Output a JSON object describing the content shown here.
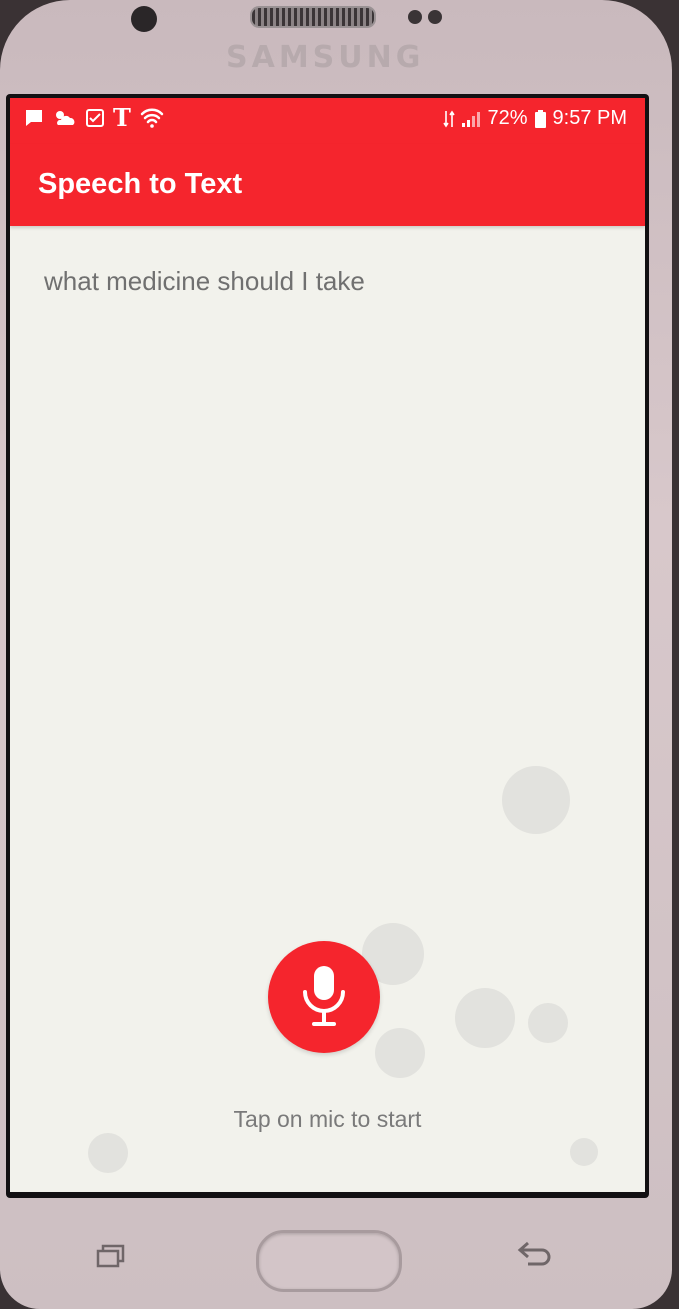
{
  "device": {
    "brand": "SAMSUNG"
  },
  "status_bar": {
    "icons_left": [
      "message-icon",
      "weather-icon",
      "checkbox-icon",
      "tmobile-icon",
      "wifi-icon"
    ],
    "carrier_glyph": "T",
    "battery": "72%",
    "time": "9:57 PM"
  },
  "app_bar": {
    "title": "Speech to Text"
  },
  "main": {
    "transcript": "what medicine should I take",
    "hint": "Tap on mic to start"
  },
  "colors": {
    "accent": "#f5252d",
    "background": "#f2f2ec",
    "text": "#707070"
  }
}
